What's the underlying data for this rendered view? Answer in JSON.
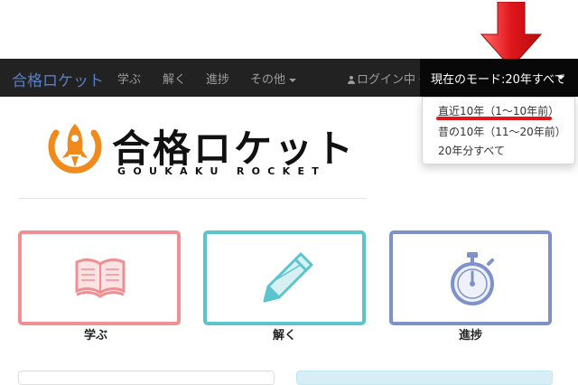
{
  "navbar": {
    "brand": "合格ロケット",
    "items": [
      {
        "label": "学ぶ"
      },
      {
        "label": "解く"
      },
      {
        "label": "進捗"
      },
      {
        "label": "その他"
      }
    ],
    "login_label": "ログイン中",
    "mode_label": "現在のモード:20年すべて"
  },
  "dropdown": {
    "items": [
      {
        "label": "直近10年（1〜10年前）"
      },
      {
        "label": "昔の10年（11〜20年前）"
      },
      {
        "label": "20年分すべて"
      }
    ]
  },
  "logo": {
    "title": "合格ロケット",
    "subtitle": "GOUKAKU ROCKET"
  },
  "cards": [
    {
      "label": "学ぶ",
      "icon": "open-book-icon",
      "color": "#ef8f93"
    },
    {
      "label": "解く",
      "icon": "pencil-icon",
      "color": "#5cc4cd"
    },
    {
      "label": "進捗",
      "icon": "stopwatch-icon",
      "color": "#7e92c9"
    }
  ],
  "colors": {
    "navbar_bg": "#222222",
    "brand": "#5a7fc0",
    "annotation_red": "#e0161b",
    "rocket_orange": "#f08a1c"
  }
}
